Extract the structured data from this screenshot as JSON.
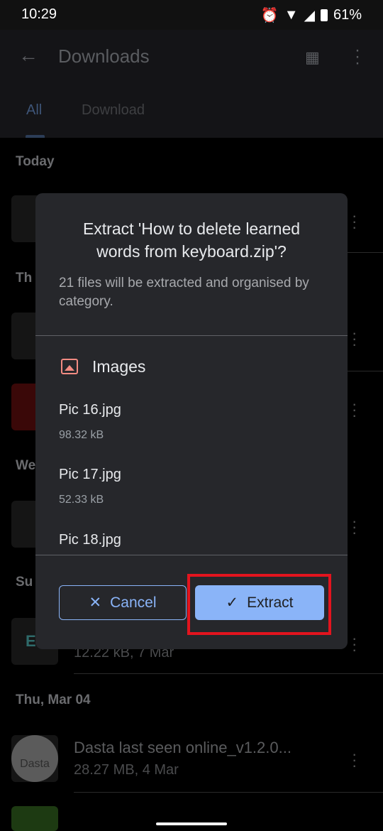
{
  "status": {
    "time": "10:29",
    "battery": "61%",
    "icons": [
      "alarm-icon",
      "wifi-icon",
      "signal-icon",
      "battery-icon"
    ]
  },
  "appbar": {
    "title": "Downloads",
    "tabs": [
      "All",
      "Download"
    ]
  },
  "list": {
    "sections": [
      "Today",
      "Th",
      "We",
      "Su",
      "Thu, Mar 04"
    ],
    "items": [
      {
        "meta": "12.22 kB, 7 Mar"
      },
      {
        "name": "Dasta last seen online_v1.2.0...",
        "meta": "28.27 MB, 4 Mar",
        "thumb_label": "Dasta"
      }
    ]
  },
  "dialog": {
    "title": "Extract 'How to delete learned words from keyboard.zip'?",
    "subtitle": "21 files will be extracted and organised by category.",
    "category": "Images",
    "files": [
      {
        "name": "Pic 16.jpg",
        "size": "98.32 kB"
      },
      {
        "name": "Pic 17.jpg",
        "size": "52.33 kB"
      },
      {
        "name": "Pic 18.jpg"
      }
    ],
    "cancel": "Cancel",
    "extract": "Extract"
  },
  "colors": {
    "accent": "#8ab4f8",
    "highlight": "#e3141e",
    "dialog_bg": "#26272b",
    "image_icon": "#f28b82"
  }
}
